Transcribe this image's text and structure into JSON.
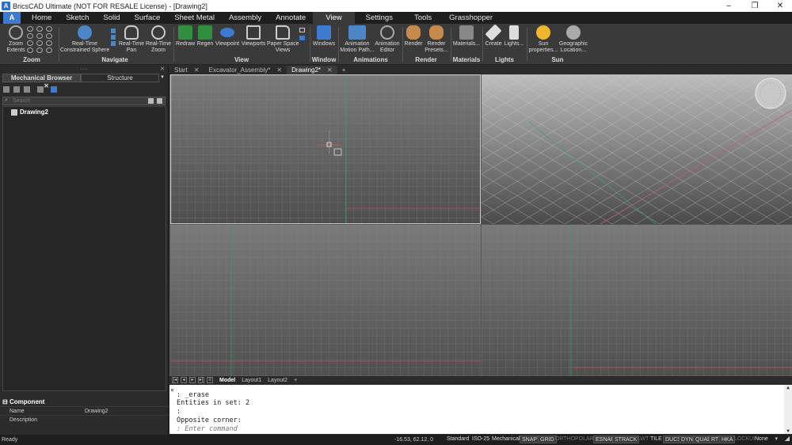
{
  "window": {
    "title": "BricsCAD Ultimate (NOT FOR RESALE License) - [Drawing2]",
    "controls": [
      "–",
      "❐",
      "✕"
    ]
  },
  "ribbon_tabs": [
    "Home",
    "Sketch",
    "Solid",
    "Surface",
    "Sheet Metal",
    "Assembly",
    "Annotate",
    "View",
    "Settings",
    "Tools",
    "Grasshopper"
  ],
  "active_tab": "View",
  "ribbon": {
    "zoom_extents": "Zoom\nExtents",
    "group_zoom": "Zoom",
    "constrained_sphere": "Real-Time\nConstrained Sphere",
    "pan": "Real-Time\nPan",
    "rt_zoom": "Real-Time\nZoom",
    "group_navigate": "Navigate",
    "redraw": "Redraw",
    "regen": "Regen",
    "viewpoint": "Viewpoint",
    "viewports": "Viewports",
    "paper_space_views": "Paper Space\nViews",
    "group_view": "View",
    "windows": "Windows",
    "group_window": "Window",
    "animation_motion_path": "Animation\nMotion Path...",
    "animation_editor": "Animation\nEditor",
    "group_animations": "Animations",
    "render": "Render",
    "render_presets": "Render\nPresets...",
    "group_render": "Render",
    "materials": "Materials...",
    "group_materials": "Materials",
    "create": "Create",
    "lights": "Lights...",
    "group_lights": "Lights",
    "sun_properties": "Sun\nproperties...",
    "geographic_location": "Geographic\nLocation...",
    "group_sun": "Sun"
  },
  "left_panel": {
    "tabs": [
      "Mechanical Browser",
      "Structure"
    ],
    "search_placeholder": "Search",
    "tree_root": "Drawing2",
    "component_header": "Component",
    "properties": [
      {
        "key": "Name",
        "value": "Drawing2"
      },
      {
        "key": "Description",
        "value": ""
      }
    ]
  },
  "doc_tabs": [
    "Start",
    "Excavator_Assembly*",
    "Drawing2*"
  ],
  "active_doc": "Drawing2*",
  "layout_tabs": [
    "Model",
    "Layout1",
    "Layout2"
  ],
  "command_lines": [
    ": _erase",
    "Entities in set: 2",
    ":",
    "Opposite corner:"
  ],
  "command_placeholder": ": Enter command",
  "status": {
    "ready": "Ready",
    "coords": "-16.53, 62.12, 0",
    "items": [
      {
        "label": "Standard",
        "state": "plain"
      },
      {
        "label": "ISO-25",
        "state": "plain"
      },
      {
        "label": "Mechanical",
        "state": "plain"
      },
      {
        "label": "SNAP",
        "state": "on"
      },
      {
        "label": "GRID",
        "state": "on"
      },
      {
        "label": "ORTHO",
        "state": "off"
      },
      {
        "label": "POLAR",
        "state": "off"
      },
      {
        "label": "ESNAP",
        "state": "on"
      },
      {
        "label": "STRACK",
        "state": "on"
      },
      {
        "label": "LWT",
        "state": "off"
      },
      {
        "label": "TILE",
        "state": "plain"
      },
      {
        "label": "DUCS",
        "state": "on"
      },
      {
        "label": "DYN",
        "state": "on"
      },
      {
        "label": "QUAD",
        "state": "on"
      },
      {
        "label": "RT",
        "state": "on"
      },
      {
        "label": "HKA",
        "state": "on"
      },
      {
        "label": "LOCKUI",
        "state": "off"
      },
      {
        "label": "None",
        "state": "plain"
      }
    ]
  }
}
